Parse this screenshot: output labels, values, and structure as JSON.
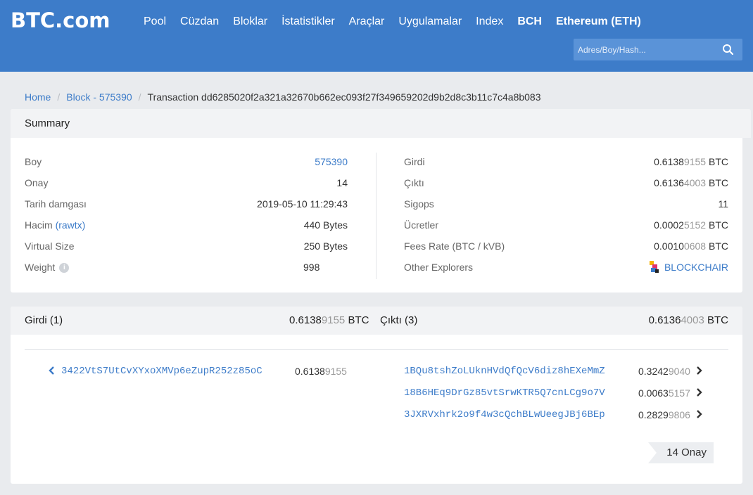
{
  "header": {
    "logo": "BTC.com",
    "nav": [
      "Pool",
      "Cüzdan",
      "Bloklar",
      "İstatistikler",
      "Araçlar",
      "Uygulamalar",
      "Index"
    ],
    "nav_bold": [
      "BCH",
      "Ethereum (ETH)"
    ],
    "search_placeholder": "Adres/Boy/Hash..."
  },
  "breadcrumb": {
    "home": "Home",
    "block": "Block - 575390",
    "current": "Transaction dd6285020f2a321a32670b662ec093f27f349659202d9b2d8c3b11c7c4a8b083"
  },
  "summary": {
    "title": "Summary",
    "left": {
      "boy_label": "Boy",
      "boy_value": "575390",
      "onay_label": "Onay",
      "onay_value": "14",
      "tarih_label": "Tarih damgası",
      "tarih_value": "2019-05-10 11:29:43",
      "hacim_label": "Hacim",
      "hacim_link": "(rawtx)",
      "hacim_value": "440",
      "hacim_unit": "Bytes",
      "vsize_label": "Virtual Size",
      "vsize_value": "250",
      "vsize_unit": "Bytes",
      "weight_label": "Weight",
      "weight_info": "i",
      "weight_value": "998"
    },
    "right": {
      "girdi_label": "Girdi",
      "girdi_main": "0.6138",
      "girdi_dim": "9155",
      "girdi_unit": "BTC",
      "cikti_label": "Çıktı",
      "cikti_main": "0.6136",
      "cikti_dim": "4003",
      "cikti_unit": "BTC",
      "sigops_label": "Sigops",
      "sigops_value": "11",
      "ucret_label": "Ücretler",
      "ucret_main": "0.0002",
      "ucret_dim": "5152",
      "ucret_unit": "BTC",
      "fees_label": "Fees Rate (BTC / kVB)",
      "fees_main": "0.0010",
      "fees_dim": "0608",
      "fees_unit": "BTC",
      "explorers_label": "Other Explorers",
      "explorers_value": "BLOCKCHAIR"
    }
  },
  "tx": {
    "inputs_title": "Girdi (1)",
    "inputs_main": "0.6138",
    "inputs_dim": "9155",
    "inputs_unit": "BTC",
    "outputs_title": "Çıktı (3)",
    "outputs_main": "0.6136",
    "outputs_dim": "4003",
    "outputs_unit": "BTC",
    "input_address": "3422VtS7UtCvXYxoXMVp6eZupR252z85oC",
    "input_main": "0.6138",
    "input_dim": "9155",
    "outputs": [
      {
        "address": "1BQu8tshZoLUknHVdQfQcV6diz8hEXeMmZ",
        "main": "0.3242",
        "dim": "9040"
      },
      {
        "address": "18B6HEq9DrGz85vtSrwKTR5Q7cnLCg9o7V",
        "main": "0.0063",
        "dim": "5157"
      },
      {
        "address": "3JXRVxhrk2o9f4w3cQchBLwUeegJBj6BEp",
        "main": "0.2829",
        "dim": "9806"
      }
    ],
    "confirmations": "14 Onay"
  },
  "colors": {
    "brand": "#3d7cc9",
    "link": "#3d7cc9"
  }
}
